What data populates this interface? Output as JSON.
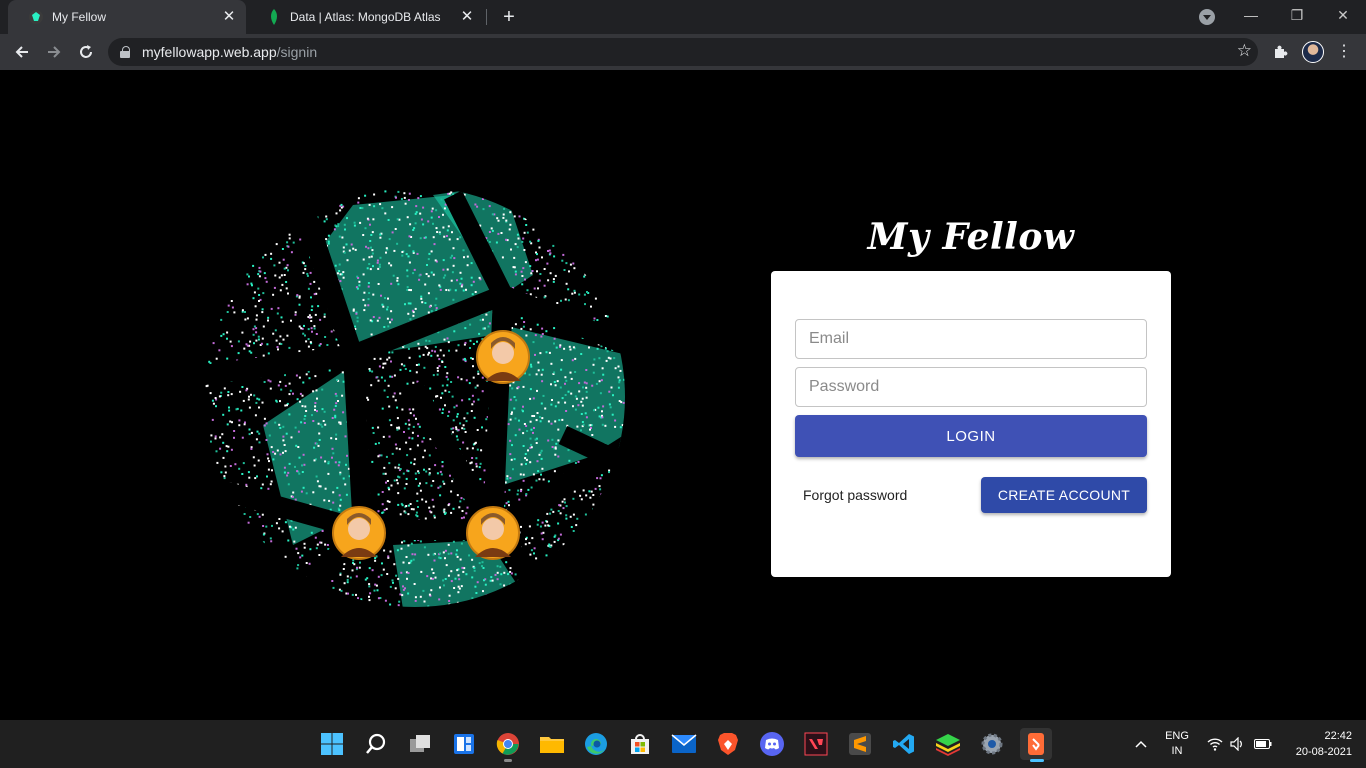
{
  "browser": {
    "tabs": [
      {
        "title": "My Fellow",
        "active": true
      },
      {
        "title": "Data | Atlas: MongoDB Atlas",
        "active": false
      }
    ],
    "new_tab": "+",
    "url_host": "myfellowapp.web.app",
    "url_path": "/signin"
  },
  "app": {
    "brand": "My Fellow",
    "email_placeholder": "Email",
    "password_placeholder": "Password",
    "login_label": "LOGIN",
    "forgot_label": "Forgot password",
    "create_label": "CREATE ACCOUNT",
    "colors": {
      "primary": "#3f51b5",
      "secondary": "#2f4aa8",
      "accent": "#29f0c2",
      "avatar": "#f7a51c"
    }
  },
  "taskbar": {
    "apps": [
      "windows-start",
      "search",
      "task-view",
      "widgets",
      "chrome",
      "file-explorer",
      "edge",
      "store",
      "mail",
      "brave",
      "discord",
      "valorant",
      "sublime-text",
      "vscode",
      "bluestacks",
      "settings",
      "postman"
    ],
    "language": "ENG",
    "region": "IN",
    "time": "22:42",
    "date": "20-08-2021"
  }
}
